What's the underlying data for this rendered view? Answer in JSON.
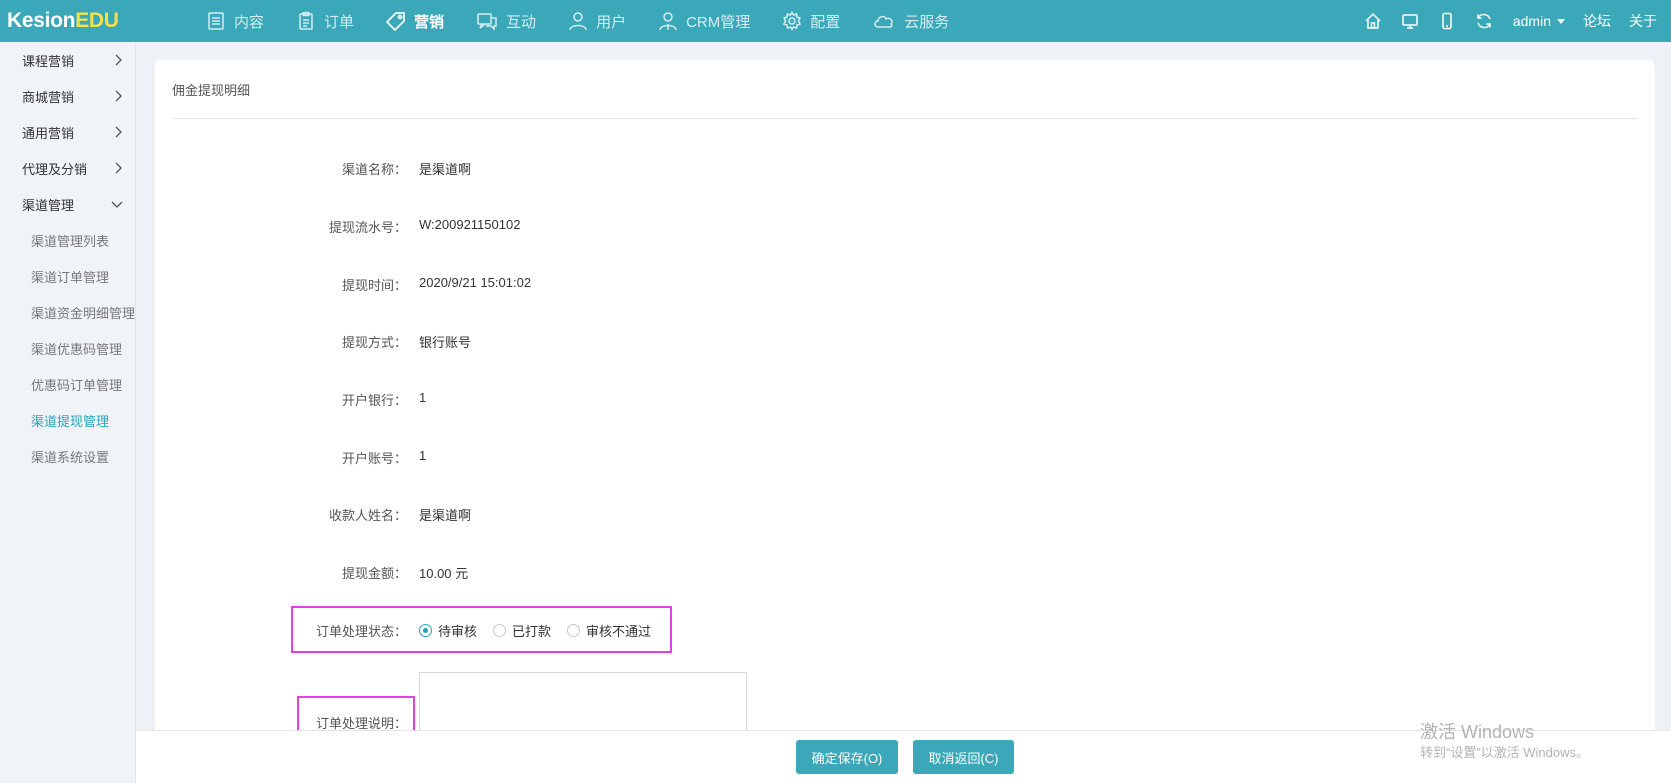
{
  "brand": {
    "kesion": "Kesion",
    "edu": "EDU"
  },
  "nav": [
    {
      "label": "内容",
      "icon": "document-icon"
    },
    {
      "label": "订单",
      "icon": "clipboard-icon"
    },
    {
      "label": "营销",
      "icon": "tag-icon",
      "active": true
    },
    {
      "label": "互动",
      "icon": "chat-icon"
    },
    {
      "label": "用户",
      "icon": "user-icon"
    },
    {
      "label": "CRM管理",
      "icon": "crm-user-icon"
    },
    {
      "label": "配置",
      "icon": "gear-icon"
    },
    {
      "label": "云服务",
      "icon": "cloud-icon"
    }
  ],
  "topright": {
    "user": "admin",
    "forum": "论坛",
    "about": "关于"
  },
  "sidebar": {
    "groups": [
      {
        "label": "课程营销"
      },
      {
        "label": "商城营销"
      },
      {
        "label": "通用营销"
      },
      {
        "label": "代理及分销"
      },
      {
        "label": "渠道管理"
      }
    ],
    "subitems": [
      {
        "label": "渠道管理列表"
      },
      {
        "label": "渠道订单管理"
      },
      {
        "label": "渠道资金明细管理"
      },
      {
        "label": "渠道优惠码管理"
      },
      {
        "label": "优惠码订单管理"
      },
      {
        "label": "渠道提现管理"
      },
      {
        "label": "渠道系统设置"
      }
    ]
  },
  "panel": {
    "title": "佣金提现明细",
    "fields": [
      {
        "label": "渠道名称：",
        "value": "是渠道啊"
      },
      {
        "label": "提现流水号：",
        "value": "W:200921150102"
      },
      {
        "label": "提现时间：",
        "value": "2020/9/21 15:01:02"
      },
      {
        "label": "提现方式：",
        "value": "银行账号"
      },
      {
        "label": "开户银行：",
        "value": "1"
      },
      {
        "label": "开户账号：",
        "value": "1"
      },
      {
        "label": "收款人姓名：",
        "value": "是渠道啊"
      },
      {
        "label": "提现金额：",
        "value": "10.00 元"
      }
    ],
    "status_label": "订单处理状态：",
    "status_options": [
      "待审核",
      "已打款",
      "审核不通过"
    ],
    "note_label": "订单处理说明："
  },
  "buttons": {
    "save": "确定保存(O)",
    "cancel": "取消返回(C)"
  },
  "watermark": {
    "line1": "激活 Windows",
    "line2": "转到“设置”以激活 Windows。"
  },
  "colors": {
    "topbar": "#3aa8b8",
    "accent": "#2aa3b6",
    "highlight": "#e23fe8",
    "brand_edu": "#f4e04a"
  }
}
